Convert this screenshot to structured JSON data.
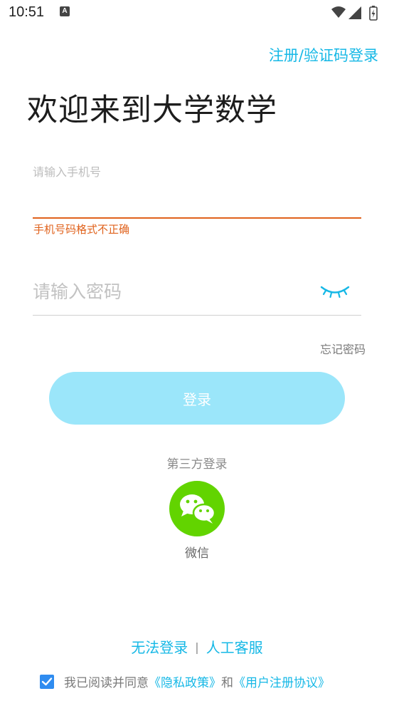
{
  "status_bar": {
    "time": "10:51",
    "notification_badge": "A"
  },
  "header": {
    "register_link": "注册/验证码登录",
    "title": "欢迎来到大学数学"
  },
  "phone": {
    "placeholder": "请输入手机号",
    "value": "",
    "error": "手机号码格式不正确"
  },
  "password": {
    "placeholder": "请输入密码",
    "value": ""
  },
  "forgot_password": "忘记密码",
  "login_button": "登录",
  "third_party": {
    "label": "第三方登录",
    "wechat_label": "微信"
  },
  "help": {
    "cannot_login": "无法登录",
    "separator": "|",
    "customer_service": "人工客服"
  },
  "agreement": {
    "prefix": "我已阅读并同意",
    "privacy_policy": "《隐私政策》",
    "and": "和",
    "user_agreement": "《用户注册协议》",
    "checked": true
  },
  "colors": {
    "accent": "#16b8e6",
    "error": "#e0621c",
    "button": "#9be6fa",
    "wechat": "#62d400",
    "checkbox": "#2f8cf0"
  }
}
